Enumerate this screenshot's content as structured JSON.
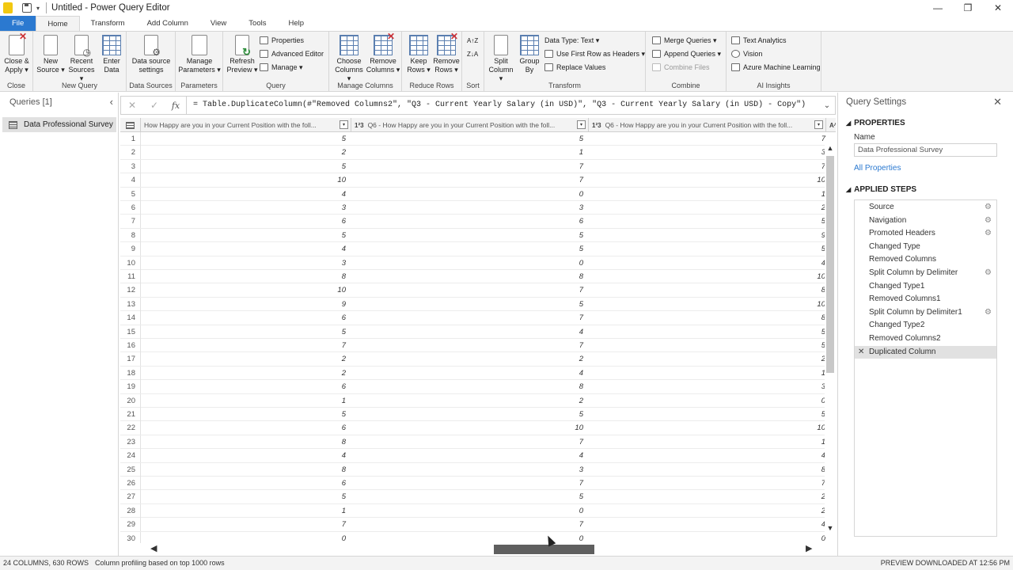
{
  "titlebar": {
    "title": "Untitled - Power Query Editor",
    "save_icon": "save-icon",
    "dropdown": "▾"
  },
  "window": {
    "minimize": "—",
    "restore": "❐",
    "close": "✕"
  },
  "tabs": [
    "File",
    "Home",
    "Transform",
    "Add Column",
    "View",
    "Tools",
    "Help"
  ],
  "ribbon": {
    "close_group": {
      "label": "Close",
      "close_apply": [
        "Close &",
        "Apply ▾"
      ]
    },
    "new_query": {
      "label": "New Query",
      "new_source": [
        "New",
        "Source ▾"
      ],
      "recent_sources": [
        "Recent",
        "Sources ▾"
      ],
      "enter_data": [
        "Enter",
        "Data"
      ]
    },
    "data_sources": {
      "label": "Data Sources",
      "settings": [
        "Data source",
        "settings"
      ]
    },
    "parameters": {
      "label": "Parameters",
      "manage": [
        "Manage",
        "Parameters ▾"
      ]
    },
    "query": {
      "label": "Query",
      "refresh": [
        "Refresh",
        "Preview ▾"
      ],
      "properties": "Properties",
      "advanced_editor": "Advanced Editor",
      "manage": "Manage ▾"
    },
    "manage_columns": {
      "label": "Manage Columns",
      "choose": [
        "Choose",
        "Columns ▾"
      ],
      "remove": [
        "Remove",
        "Columns ▾"
      ]
    },
    "reduce_rows": {
      "label": "Reduce Rows",
      "keep": [
        "Keep",
        "Rows ▾"
      ],
      "remove": [
        "Remove",
        "Rows ▾"
      ]
    },
    "sort": {
      "label": "Sort",
      "asc": "A↑Z",
      "desc": "Z↓A"
    },
    "transform": {
      "label": "Transform",
      "split": [
        "Split",
        "Column ▾"
      ],
      "group": [
        "Group",
        "By"
      ],
      "data_type": "Data Type: Text ▾",
      "first_row": "Use First Row as Headers ▾",
      "replace": "Replace Values"
    },
    "combine": {
      "label": "Combine",
      "merge": "Merge Queries ▾",
      "append": "Append Queries ▾",
      "combine_files": "Combine Files"
    },
    "ai": {
      "label": "AI Insights",
      "text_analytics": "Text Analytics",
      "vision": "Vision",
      "azure_ml": "Azure Machine Learning"
    }
  },
  "queries": {
    "header": "Queries [1]",
    "collapse": "‹",
    "items": [
      "Data Professional Survey"
    ]
  },
  "formula": {
    "cancel": "✕",
    "commit": "✓",
    "fx": "fx",
    "text": "= Table.DuplicateColumn(#\"Removed Columns2\", \"Q3 - Current Yearly Salary (in USD)\", \"Q3 - Current Yearly Salary (in USD) - Copy\")",
    "expand": "⌄"
  },
  "grid": {
    "columns": [
      {
        "type": "",
        "label": "How Happy are you in your Current Position with the foll..."
      },
      {
        "type": "1²3",
        "label": "Q6 - How Happy are you in your Current Position with the foll..."
      },
      {
        "type": "1²3",
        "label": "Q6 - How Happy are you in your Current Position with the foll..."
      },
      {
        "type": "A^B_C",
        "label": ""
      }
    ],
    "rows": [
      [
        1,
        5,
        5,
        7
      ],
      [
        2,
        2,
        1,
        3
      ],
      [
        3,
        5,
        7,
        7
      ],
      [
        4,
        10,
        7,
        10
      ],
      [
        5,
        4,
        0,
        1
      ],
      [
        6,
        3,
        3,
        2
      ],
      [
        7,
        6,
        6,
        5
      ],
      [
        8,
        5,
        5,
        9
      ],
      [
        9,
        4,
        5,
        5
      ],
      [
        10,
        3,
        0,
        4
      ],
      [
        11,
        8,
        8,
        10
      ],
      [
        12,
        10,
        7,
        8
      ],
      [
        13,
        9,
        5,
        10
      ],
      [
        14,
        6,
        7,
        8
      ],
      [
        15,
        5,
        4,
        5
      ],
      [
        16,
        7,
        7,
        5
      ],
      [
        17,
        2,
        2,
        2
      ],
      [
        18,
        2,
        4,
        1
      ],
      [
        19,
        6,
        8,
        3
      ],
      [
        20,
        1,
        2,
        0
      ],
      [
        21,
        5,
        5,
        5
      ],
      [
        22,
        6,
        10,
        10
      ],
      [
        23,
        8,
        7,
        1
      ],
      [
        24,
        4,
        4,
        4
      ],
      [
        25,
        8,
        3,
        8
      ],
      [
        26,
        6,
        7,
        7
      ],
      [
        27,
        5,
        5,
        2
      ],
      [
        28,
        1,
        0,
        2
      ],
      [
        29,
        7,
        7,
        4
      ],
      [
        30,
        0,
        0,
        0
      ]
    ]
  },
  "settings": {
    "title": "Query Settings",
    "close": "✕",
    "properties": "PROPERTIES",
    "name_label": "Name",
    "name_value": "Data Professional Survey",
    "all_properties": "All Properties",
    "applied_steps": "APPLIED STEPS",
    "steps": [
      {
        "label": "Source",
        "gear": true
      },
      {
        "label": "Navigation",
        "gear": true
      },
      {
        "label": "Promoted Headers",
        "gear": true
      },
      {
        "label": "Changed Type",
        "gear": false
      },
      {
        "label": "Removed Columns",
        "gear": false
      },
      {
        "label": "Split Column by Delimiter",
        "gear": true
      },
      {
        "label": "Changed Type1",
        "gear": false
      },
      {
        "label": "Removed Columns1",
        "gear": false
      },
      {
        "label": "Split Column by Delimiter1",
        "gear": true
      },
      {
        "label": "Changed Type2",
        "gear": false
      },
      {
        "label": "Removed Columns2",
        "gear": false
      },
      {
        "label": "Duplicated Column",
        "gear": false,
        "active": true
      }
    ]
  },
  "status": {
    "left": "24 COLUMNS, 630 ROWS",
    "middle": "Column profiling based on top 1000 rows",
    "right": "PREVIEW DOWNLOADED AT 12:56 PM"
  }
}
